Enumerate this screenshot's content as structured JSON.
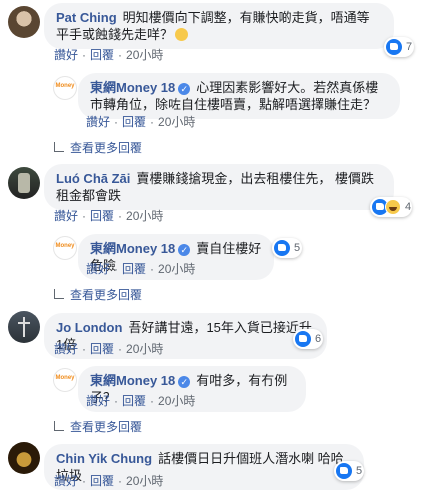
{
  "common": {
    "like": "讚好",
    "reply": "回覆",
    "separator": "·",
    "more_replies": "查看更多回覆"
  },
  "threads": [
    {
      "author": "Pat Ching",
      "text": "明知樓價向下調整，有賺快啲走貨，唔通等平手或蝕錢先走咩？",
      "time": "20小時",
      "reactions": "7",
      "reply": {
        "author": "東網Money 18",
        "text": "心理因素影響好大。若然真係樓市轉角位，除咗自住樓唔賣，點解唔選擇賺住走？",
        "time": "20小時"
      }
    },
    {
      "author": "Luó Chā Zāi",
      "text": "賣樓賺錢搶現金，出去租樓住先， 樓價跌租金都會跌",
      "time": "20小時",
      "reactions": "4",
      "reply": {
        "author": "東網Money 18",
        "text": "賣自住樓好危險",
        "time": "20小時",
        "reactions": "5"
      }
    },
    {
      "author": "Jo London",
      "text": "吾好講甘遠，15年入貨已接近升1倍",
      "time": "20小時",
      "reactions": "6",
      "reply": {
        "author": "東網Money 18",
        "text": "有咁多，有冇例子？",
        "time": "20小時"
      }
    },
    {
      "author": "Chin Yik Chung",
      "text": "話樓價日日升個班人潛水喇 哈哈 垃圾",
      "time": "20小時",
      "reactions": "5"
    }
  ],
  "money_logo_text": "Money"
}
